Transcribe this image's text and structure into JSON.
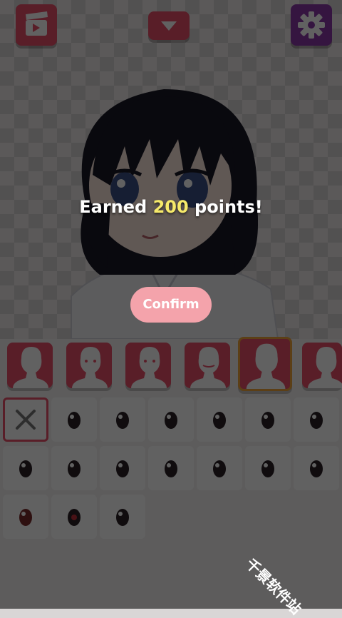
{
  "dialog": {
    "message_prefix": "Earned ",
    "points": "200",
    "message_suffix": " points!",
    "confirm_label": "Confirm"
  },
  "toolbar": {
    "left_icon": "video-clapper-icon",
    "center_icon": "chevron-down-icon",
    "right_icon": "gear-icon"
  },
  "part_tabs": {
    "count": 6,
    "selected_index": 4
  },
  "eye_grid": {
    "first_cell": "none-x-icon",
    "items": 17
  },
  "watermark": "千景软件站",
  "colors": {
    "accent_pink": "#e9506a",
    "purple": "#8b39a8",
    "confirm": "#f4a3ab",
    "points_highlight": "#f6ea6a",
    "selected_border": "#f2a53a"
  }
}
